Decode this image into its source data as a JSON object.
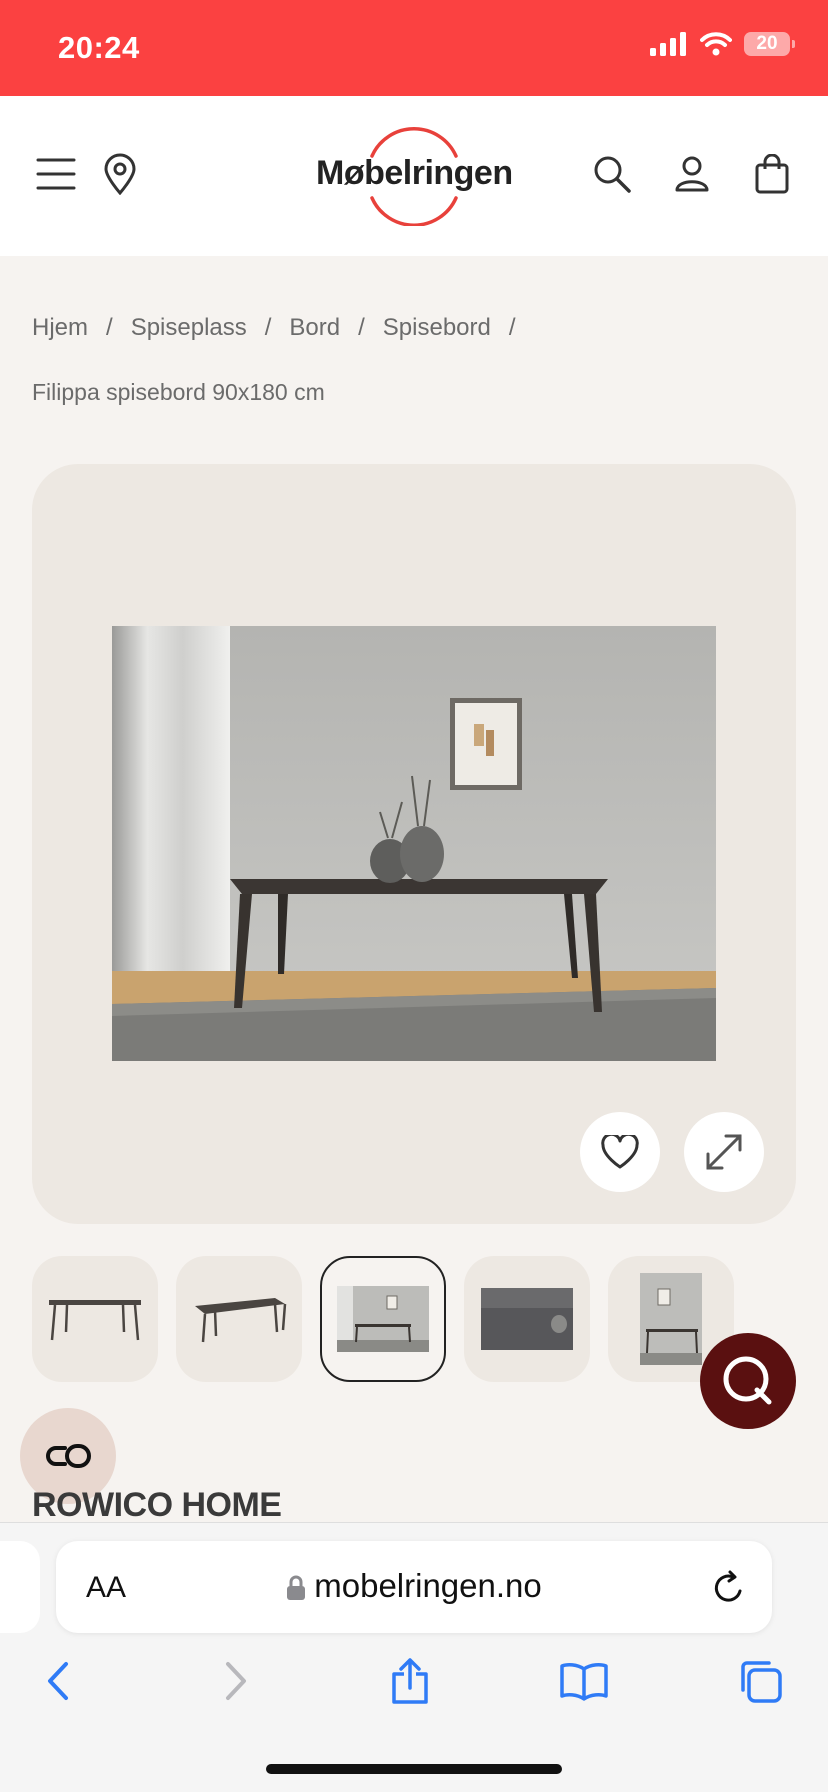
{
  "status_bar": {
    "time": "20:24",
    "battery": "20"
  },
  "header": {
    "logo": "Møbelringen",
    "brand_color": "#e8413b"
  },
  "breadcrumb": {
    "items": [
      "Hjem",
      "Spiseplass",
      "Bord",
      "Spisebord"
    ],
    "separator": "/",
    "current": "Filippa spisebord 90x180 cm"
  },
  "product": {
    "brand": "ROWICO HOME"
  },
  "browser": {
    "text_size": "AA",
    "url": "mobelringen.no"
  },
  "icons": {
    "header": [
      "menu-icon",
      "location-icon",
      "search-icon",
      "account-icon",
      "cart-icon"
    ],
    "gallery": [
      "heart-icon",
      "expand-icon"
    ],
    "toolbar": [
      "back-icon",
      "forward-icon",
      "share-icon",
      "bookmarks-icon",
      "tabs-icon"
    ]
  },
  "colors": {
    "status_bar": "#fb4141",
    "chat": "#5a1010",
    "safari_blue": "#2f7bf6"
  }
}
